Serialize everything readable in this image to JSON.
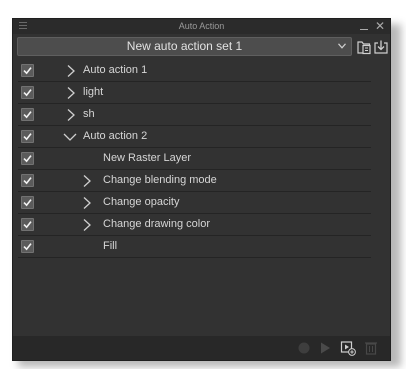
{
  "window": {
    "title": "Auto Action"
  },
  "set_selector": {
    "value": "New auto action set 1"
  },
  "actions": [
    {
      "label": "Auto action 1",
      "checked": true,
      "expander": "collapsed",
      "level": 0
    },
    {
      "label": "light",
      "checked": true,
      "expander": "collapsed",
      "level": 0
    },
    {
      "label": "sh",
      "checked": true,
      "expander": "collapsed",
      "level": 0
    },
    {
      "label": "Auto action 2",
      "checked": true,
      "expander": "expanded",
      "level": 0
    },
    {
      "label": "New Raster Layer",
      "checked": true,
      "expander": "none",
      "level": 1
    },
    {
      "label": "Change blending mode",
      "checked": true,
      "expander": "collapsed",
      "level": 1
    },
    {
      "label": "Change opacity",
      "checked": true,
      "expander": "collapsed",
      "level": 1
    },
    {
      "label": "Change drawing color",
      "checked": true,
      "expander": "collapsed",
      "level": 1
    },
    {
      "label": "Fill",
      "checked": true,
      "expander": "none",
      "level": 1
    }
  ],
  "icons": {
    "menu": "hamburger-icon",
    "minimize": "minimize-icon",
    "close": "close-icon",
    "dropdown": "chevron-down-icon",
    "new_set": "new-set-icon",
    "import": "import-icon",
    "record": "record-icon",
    "play": "play-icon",
    "add_action": "add-action-icon",
    "delete": "trash-icon"
  },
  "colors": {
    "panel_bg": "#323232",
    "titlebar_bg": "#2b2b2b",
    "text": "#d6d6d6",
    "checkbox_bg": "#5b5b5b"
  }
}
